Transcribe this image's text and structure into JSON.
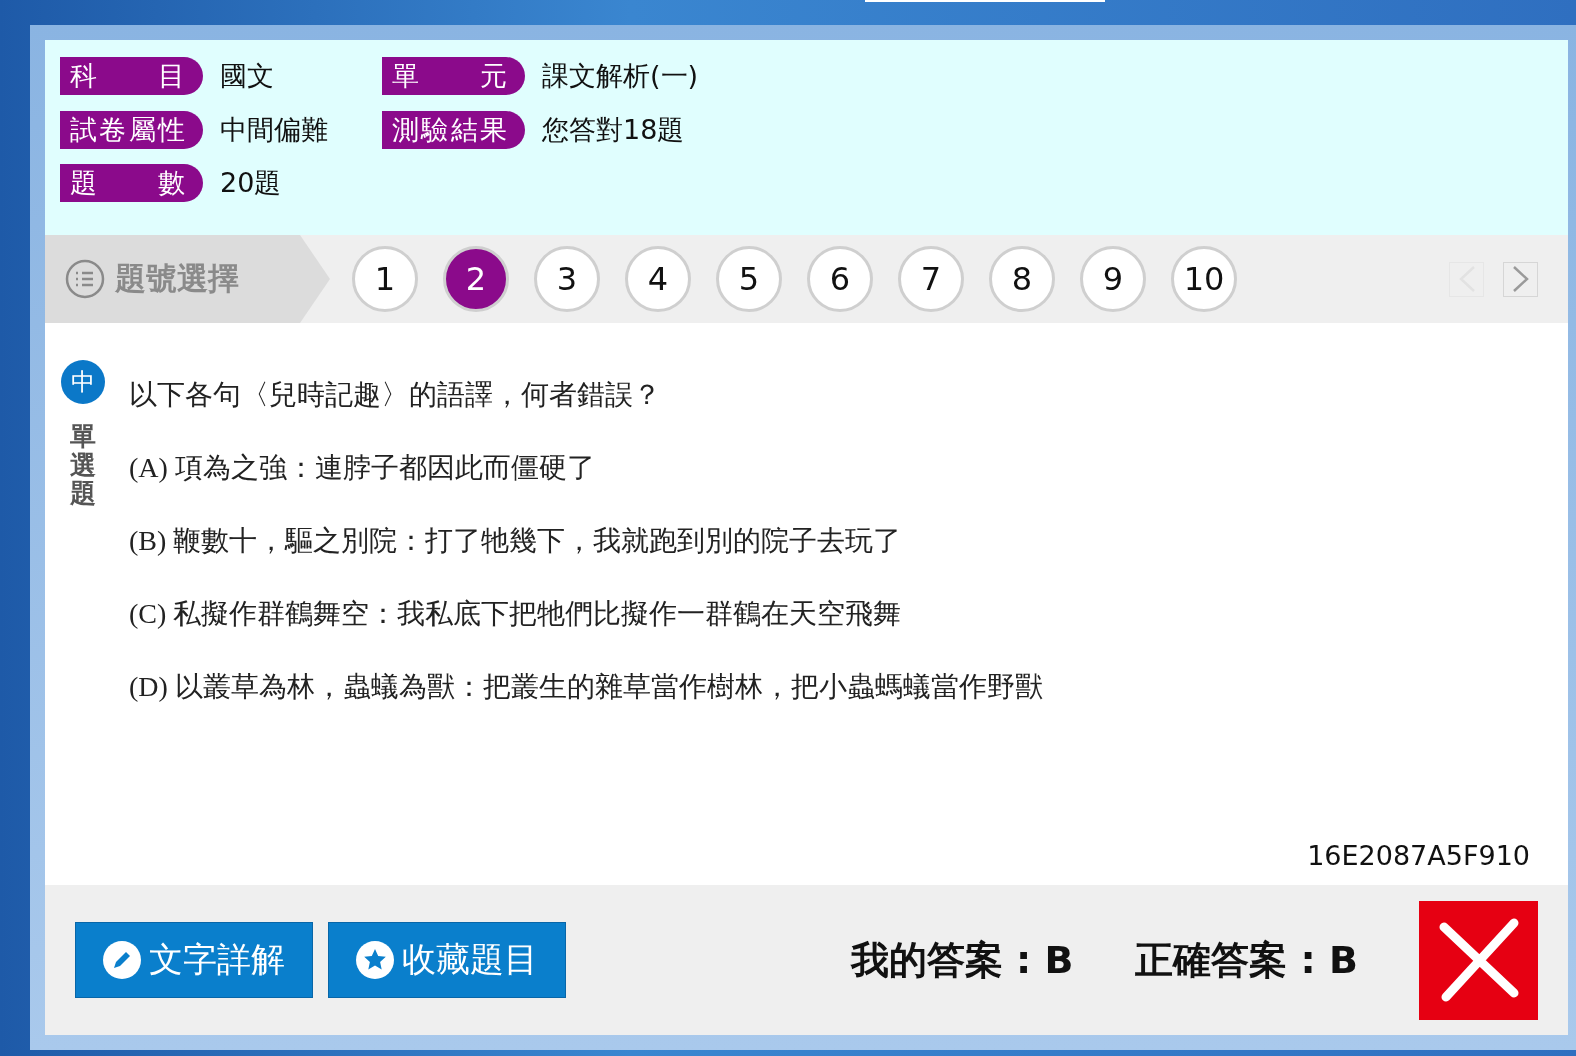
{
  "info": [
    {
      "label": "科 目",
      "value": "國文"
    },
    {
      "label": "單 元",
      "value": "課文解析(一)"
    },
    {
      "label": "試卷屬性",
      "value": "中間偏難"
    },
    {
      "label": "測驗結果",
      "value": "您答對18題"
    },
    {
      "label": "題 數",
      "value": "20題"
    }
  ],
  "nav": {
    "title": "題號選擇",
    "numbers": [
      {
        "label": "1",
        "selected": false
      },
      {
        "label": "2",
        "selected": true
      },
      {
        "label": "3",
        "selected": false
      },
      {
        "label": "4",
        "selected": false
      },
      {
        "label": "5",
        "selected": false
      },
      {
        "label": "6",
        "selected": false
      },
      {
        "label": "7",
        "selected": false
      },
      {
        "label": "8",
        "selected": false
      },
      {
        "label": "9",
        "selected": false
      },
      {
        "label": "10",
        "selected": false
      }
    ],
    "prev": {
      "disabled": true
    },
    "next": {
      "disabled": false
    }
  },
  "question": {
    "level": "中",
    "type": "單選題",
    "text": "以下各句〈兒時記趣〉的語譯，何者錯誤？",
    "options": [
      "(A) 項為之強：連脖子都因此而僵硬了",
      "(B) 鞭數十，驅之別院：打了牠幾下，我就跑到別的院子去玩了",
      "(C) 私擬作群鶴舞空：我私底下把牠們比擬作一群鶴在天空飛舞",
      "(D) 以叢草為林，蟲蟻為獸：把叢生的雜草當作樹林，把小蟲螞蟻當作野獸"
    ],
    "code": "16E2087A5F910"
  },
  "footer": {
    "buttons": [
      {
        "kind": "explain",
        "label": "文字詳解"
      },
      {
        "kind": "favorite",
        "label": "收藏題目"
      }
    ],
    "my_answer": "我的答案 : B",
    "correct_answer": "正確答案 : B",
    "correct": false
  }
}
